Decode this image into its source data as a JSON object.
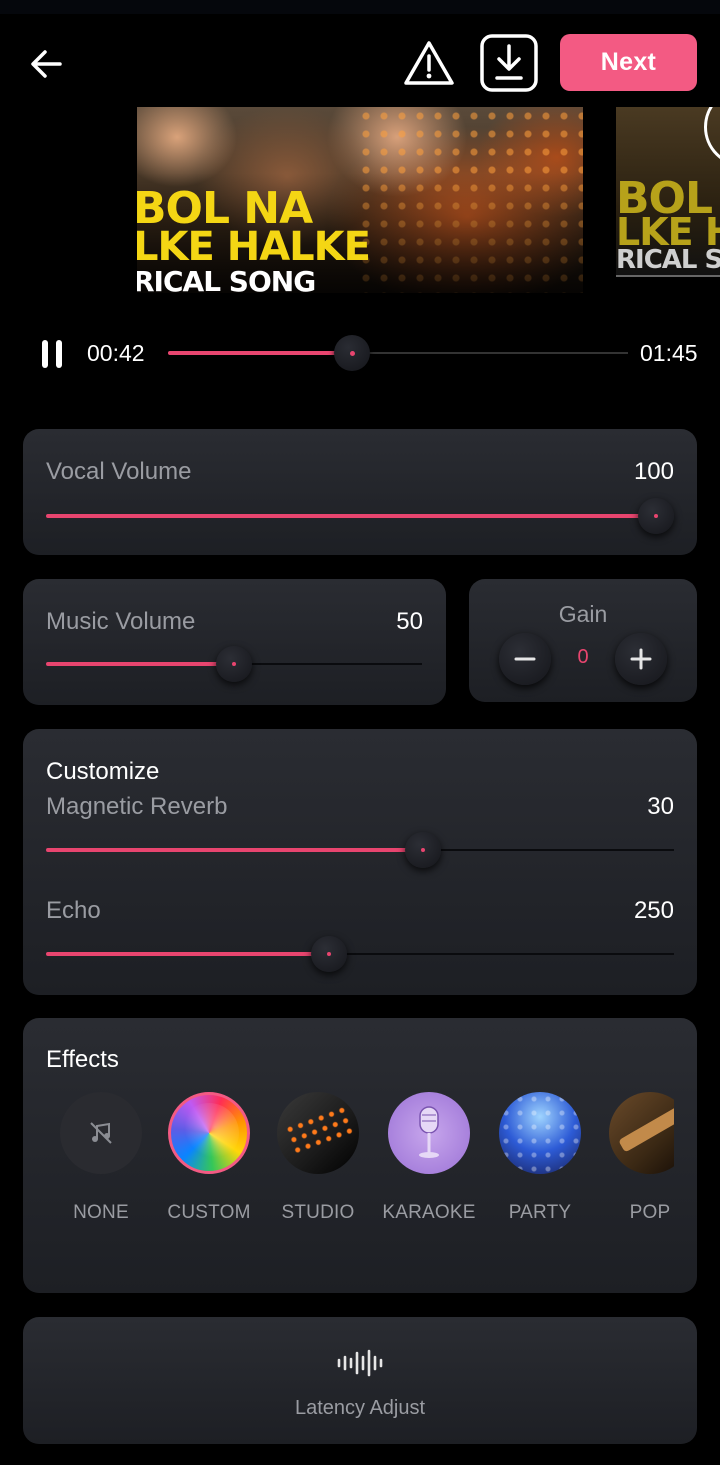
{
  "header": {
    "next_label": "Next",
    "back_icon": "back-arrow-icon",
    "warning_icon": "warning-icon",
    "download_icon": "download-icon",
    "accent": "#f35a83"
  },
  "thumbnails": [
    {
      "line1": "BOL NA",
      "line2": "LKE HALKE",
      "line3": "RICAL SONG"
    },
    {
      "line1": "BOL NA",
      "line2": "LKE H",
      "line3": "RICAL S"
    }
  ],
  "playback": {
    "current_time": "00:42",
    "total_time": "01:45",
    "progress": 0.4
  },
  "vocal_volume": {
    "label": "Vocal Volume",
    "value": "100",
    "level": 1.0
  },
  "music_volume": {
    "label": "Music Volume",
    "value": "50",
    "level": 0.5
  },
  "gain": {
    "label": "Gain",
    "value": "0",
    "minus_icon": "minus-icon",
    "plus_icon": "plus-icon"
  },
  "customize": {
    "heading": "Customize",
    "reverb": {
      "label": "Magnetic Reverb",
      "value": "30",
      "level": 0.6
    },
    "echo": {
      "label": "Echo",
      "value": "250",
      "level": 0.45
    }
  },
  "effects": {
    "heading": "Effects",
    "selected": "CUSTOM",
    "items": [
      {
        "name": "NONE",
        "icon": "music-off-icon"
      },
      {
        "name": "CUSTOM"
      },
      {
        "name": "STUDIO"
      },
      {
        "name": "KARAOKE",
        "icon": "microphone-icon"
      },
      {
        "name": "PARTY"
      },
      {
        "name": "POP"
      }
    ]
  },
  "latency": {
    "label": "Latency Adjust",
    "icon": "waveform-icon"
  }
}
